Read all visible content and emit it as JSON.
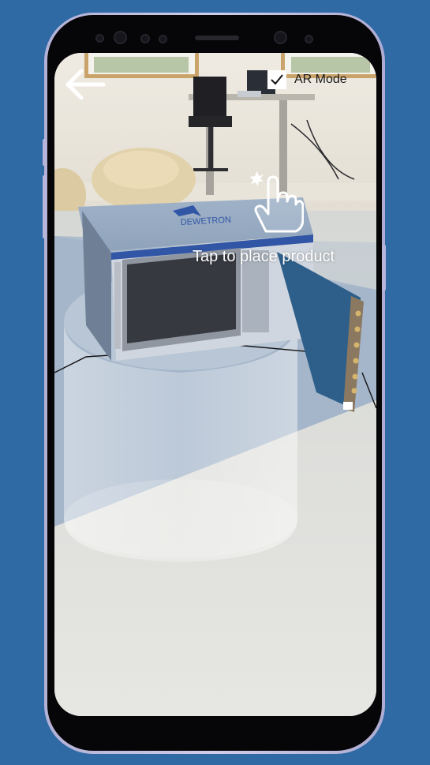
{
  "app": {
    "ar_toggle": {
      "label": "AR Mode",
      "checked": true
    },
    "hint_text": "Tap to place product",
    "product": {
      "brand": "DEWETRON"
    }
  },
  "icons": {
    "back": "arrow-left-icon",
    "check": "checkmark-icon",
    "hand": "tap-hand-icon"
  },
  "colors": {
    "background": "#2f6aa5",
    "phone_frame": "#c3c1e2",
    "accent_blue": "#3156a6"
  }
}
